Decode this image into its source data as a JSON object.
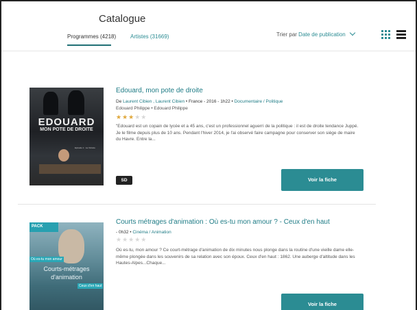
{
  "header": {
    "title": "Catalogue",
    "tabs": [
      {
        "label": "Programmes (4218)",
        "active": true
      },
      {
        "label": "Artistes (31669)",
        "active": false
      }
    ],
    "sort": {
      "prefix": "Trier par",
      "value": "Date de publication"
    },
    "view_icons": [
      "grid-view-icon",
      "list-view-icon"
    ]
  },
  "items": [
    {
      "title": "Edouard, mon pote de droite",
      "meta_prefix": "De",
      "directors": "Laurent Cibien , Laurent Cibien",
      "meta_details": "• France - 2016 - 1h22 •",
      "genre": "Documentaire / Politique",
      "cast": "Edouard Philippe • Edouard Philippe",
      "rating": 3,
      "rating_max": 5,
      "description": "\"Edouard est un copain de lycée et a 45 ans, c'est un professionnel aguerri de la politique : il est de droite tendance Juppé. Je le filme depuis plus de 10 ans. Pendant l'hiver 2014, je l'ai observé faire campagne pour conserver son siège de maire du Havre. Entre la...",
      "badge": "SD",
      "button": "Voir la fiche",
      "poster": {
        "big": "EDOUARD",
        "sub": "MON POTE DE DROITE",
        "small": "Episode 1 : La Victoire"
      }
    },
    {
      "title": "Courts métrages d'animation : Où es-tu mon amour ? - Ceux d'en haut",
      "meta_details": "- 0h32 •",
      "genre": "Cinéma / Animation",
      "rating": 0,
      "rating_max": 5,
      "description": "Où es-tu, mon amour ? Ce court-métrage d'animation de dix minutes nous plonge dans la routine d'une vieille dame elle-même plongée dans les souvenirs de sa relation avec son époux. Ceux d'en haut : 1862. Une auberge d'altitude dans les Hautes-Alpes...Chaque...",
      "button": "Voir la fiche",
      "poster": {
        "pack": "PACK",
        "tag1": "Où es-tu mon amour",
        "line1": "Courts-métrages",
        "line2": "d'animation",
        "tag2": "Ceux d'en haut"
      }
    }
  ],
  "colors": {
    "accent": "#2b8c93",
    "star": "#e0a83c"
  }
}
